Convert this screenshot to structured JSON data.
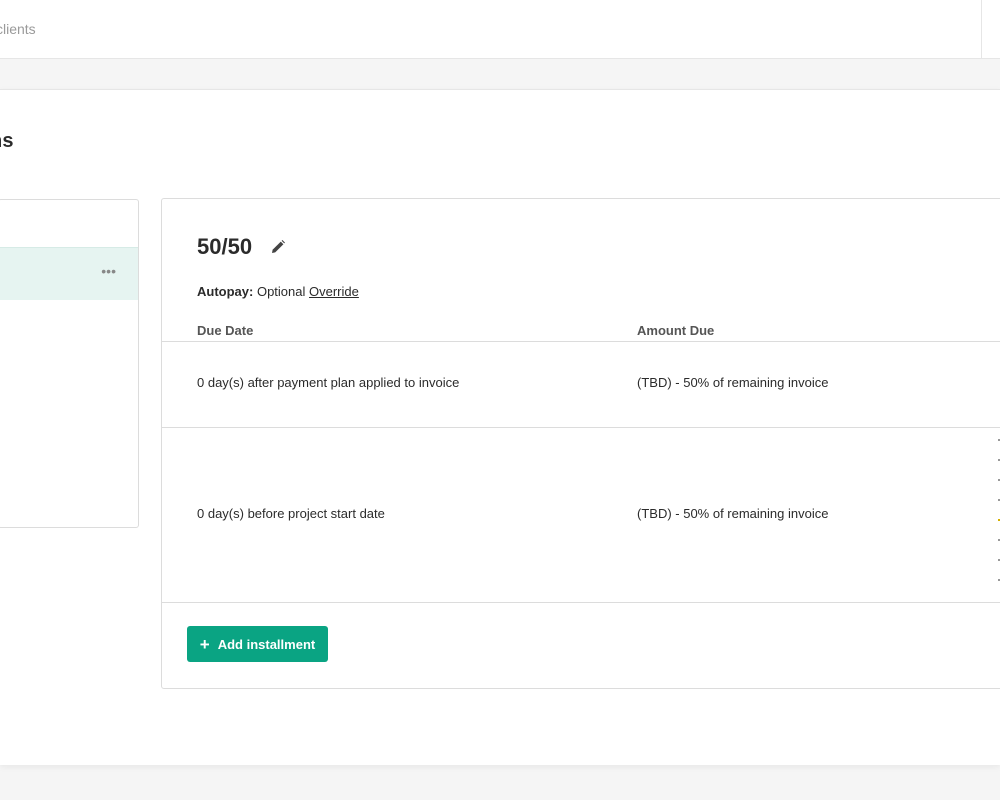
{
  "topbar": {
    "search_text": "clients"
  },
  "page": {
    "title": "ns"
  },
  "plan": {
    "name": "50/50",
    "autopay_label": "Autopay:",
    "autopay_value": "Optional",
    "override_label": "Override",
    "columns": [
      "Due Date",
      "Amount Due"
    ],
    "installments": [
      {
        "due_date": "0 day(s) after payment plan applied to invoice",
        "amount_due": "(TBD) - 50% of remaining invoice"
      },
      {
        "due_date": "0 day(s) before project start date",
        "amount_due": "(TBD) - 50% of remaining invoice"
      }
    ],
    "add_installment_label": "Add installment"
  },
  "left_panel": {
    "more_icon": "more-horizontal-icon"
  },
  "colors": {
    "accent": "#0aa483",
    "selected_bg": "#e6f4f1",
    "border": "#dcdcdc"
  }
}
